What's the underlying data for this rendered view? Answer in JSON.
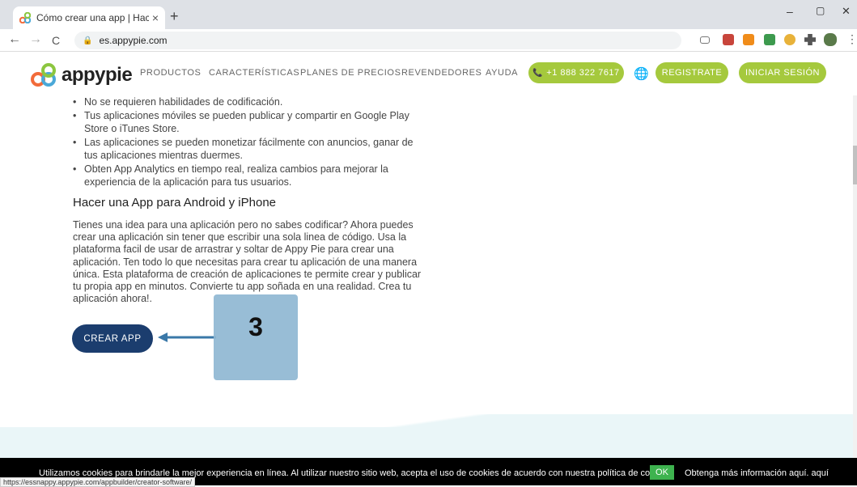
{
  "browser": {
    "tab_title": "Cómo crear una app | Hacer una",
    "tab_close": "×",
    "new_tab": "+",
    "url": "es.appypie.com",
    "minimize": "–",
    "restore": "▢",
    "close": "✕",
    "back": "←",
    "forward": "→",
    "reload": "C",
    "status_url": "https://essnappy.appypie.com/appbuilder/creator-software/"
  },
  "header": {
    "logo_text": "appypie",
    "nav": [
      "PRODUCTOS",
      "CARACTERÍSTICAS",
      "PLANES DE PRECIOS",
      "REVENDEDORES",
      "AYUDA"
    ],
    "phone": "+1 888 322 7617",
    "register": "REGISTRATE",
    "login": "INICIAR SESIÓN",
    "accent_color": "#a5c93d"
  },
  "content": {
    "bullets": [
      "No se requieren habilidades de codificación.",
      "Tus aplicaciones móviles se pueden publicar y compartir en Google Play Store o iTunes Store.",
      "Las aplicaciones se pueden monetizar fácilmente con anuncios, ganar de tus aplicaciones mientras duermes.",
      "Obten App Analytics en tiempo real, realiza cambios para mejorar la experiencia de la aplicación para tus usuarios."
    ],
    "heading": "Hacer una App para Android y iPhone",
    "paragraph": "Tienes una idea para una aplicación pero no sabes codificar? Ahora puedes crear una aplicación sin tener que escribir una sola linea de código. Usa la plataforma facil de usar de arrastrar y soltar de Appy Pie para crear una aplicación. Ten todo lo que necesitas para crear tu aplicación de una manera única. Esta plataforma de creación de aplicaciones te permite crear y publicar tu propia app en minutos. Convierte tu app soñada en una realidad. Crea tu aplicación ahora!.",
    "cta": "CREAR APP",
    "cta_color": "#1b3d6e"
  },
  "annotation": {
    "label": "3"
  },
  "cookie": {
    "text": "Utilizamos cookies para brindarle la mejor experiencia en línea. Al utilizar nuestro sitio web, acepta el uso de cookies de acuerdo con nuestra política de cookies.",
    "ok": "OK",
    "more": "Obtenga más información aquí. aquí"
  }
}
